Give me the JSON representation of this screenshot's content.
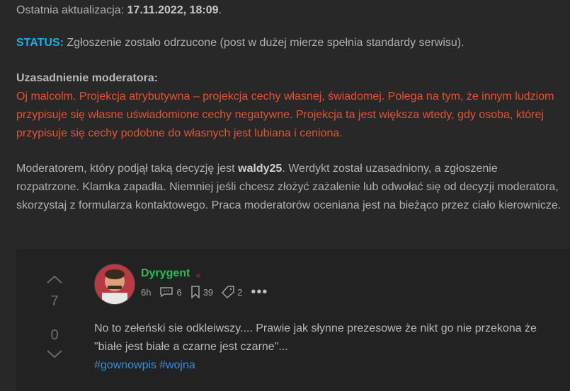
{
  "update": {
    "label": "Ostatnia aktualizacja:",
    "datetime": "17.11.2022, 18:09",
    "suffix": "."
  },
  "status": {
    "label": "STATUS:",
    "text": "Zgłoszenie zostało odrzucone (post w dużej mierze spełnia standardy serwisu)."
  },
  "justification": {
    "title": "Uzasadnienie moderatora:",
    "text": "Oj malcolm. Projekcja atrybutywna – projekcja cechy własnej, świadomej. Polega na tym, że innym ludziom przypisuje się własne uświadomione cechy negatywne. Projekcja ta jest większa wtedy, gdy osoba, której przypisuje się cechy podobne do własnych jest lubiana i ceniona."
  },
  "moderator": {
    "prefix": "Moderatorem, który podjął taką decyzję jest ",
    "name": "waldy25",
    "suffix": ". Werdykt został uzasadniony, a zgłoszenie rozpatrzone. Klamka zapadła. Niemniej jeśli chcesz złożyć zażalenie lub odwołać się od decyzji moderatora, skorzystaj z formularza kontaktowego. Praca moderatorów oceniana jest na bieżąco przez ciało kierownicze."
  },
  "comment": {
    "author": "Dyrygent",
    "time": "6h",
    "replies": "6",
    "saves": "39",
    "tags_count": "2",
    "more": "•••",
    "upvotes": "7",
    "downvotes": "0",
    "text": "No to zełeński sie odkleiwszy.... Prawie jak słynne prezesowe że nikt go nie przekona że \"białe jest białe a czarne jest czarne\"...",
    "hashtags": [
      "#gownowpis",
      "#wojna"
    ]
  },
  "colors": {
    "background": "#282828",
    "card": "#222222",
    "status_label": "#1ab0e6",
    "justification_text": "#e45236",
    "author": "#2bbd5a",
    "hashtag": "#2f8fe0"
  },
  "icons": [
    "chevron-up-icon",
    "chevron-down-icon",
    "comment-icon",
    "bookmark-icon",
    "tag-icon",
    "more-icon"
  ]
}
